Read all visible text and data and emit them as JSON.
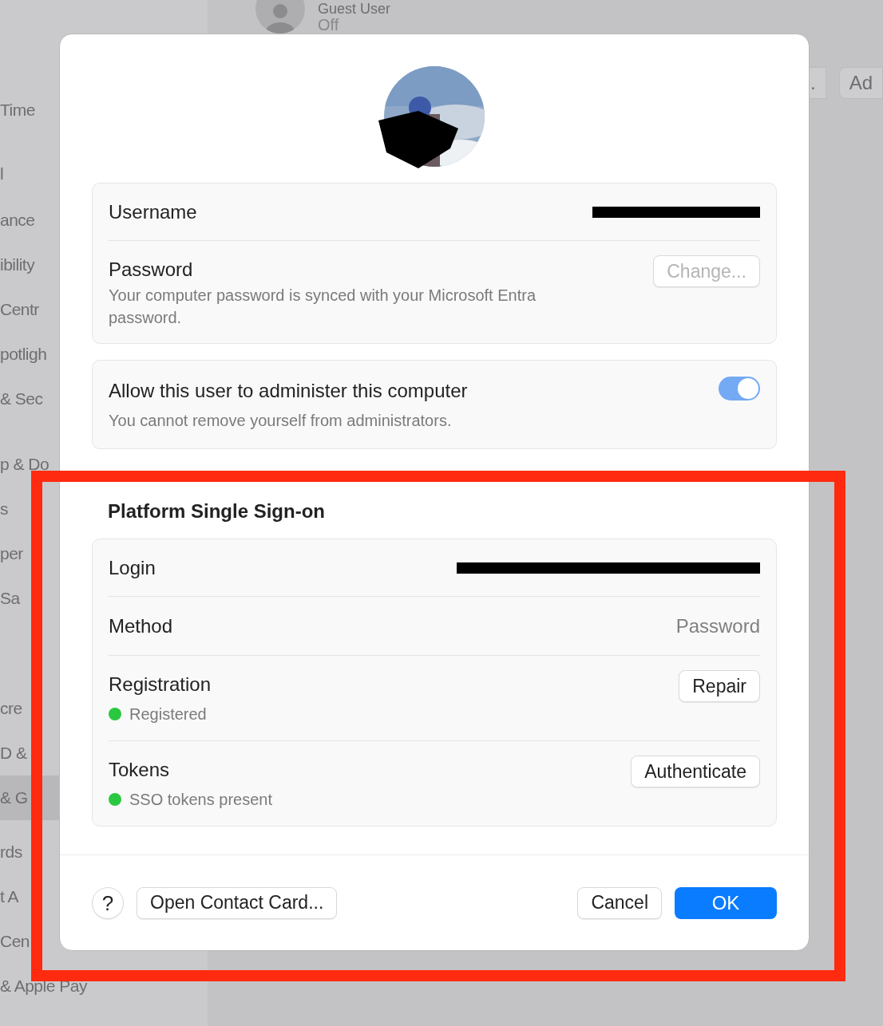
{
  "background": {
    "guest_user": {
      "name": "Guest User",
      "status": "Off"
    },
    "toolbar_buttons": [
      ".",
      "Ad"
    ],
    "sidebar": {
      "items": [
        {
          "label": "Time",
          "selected": false
        },
        {
          "label": "l",
          "selected": false
        },
        {
          "label": "ance",
          "selected": false
        },
        {
          "label": "ibility",
          "selected": false
        },
        {
          "label": "Centr",
          "selected": false
        },
        {
          "label": "potligh",
          "selected": false
        },
        {
          "label": "& Sec",
          "selected": false
        },
        {
          "label": "p & Do",
          "selected": false
        },
        {
          "label": "s",
          "selected": false
        },
        {
          "label": "per",
          "selected": false
        },
        {
          "label": "Sa",
          "selected": false
        },
        {
          "label": "cre",
          "selected": false
        },
        {
          "label": "D &",
          "selected": false
        },
        {
          "label": "& G",
          "selected": true
        },
        {
          "label": "rds",
          "selected": false
        },
        {
          "label": "t A",
          "selected": false
        },
        {
          "label": "Cen",
          "selected": false
        },
        {
          "label": "& Apple Pay",
          "selected": false
        }
      ]
    }
  },
  "dialog": {
    "account": {
      "username_label": "Username",
      "password_label": "Password",
      "password_note": "Your computer password is synced with your Microsoft Entra password.",
      "change_button": {
        "label": "Change...",
        "disabled": true
      }
    },
    "admin": {
      "label": "Allow this user to administer this computer",
      "note": "You cannot remove yourself from administrators.",
      "on": true
    },
    "sso": {
      "title": "Platform Single Sign-on",
      "rows": [
        {
          "kind": "redacted",
          "label": "Login"
        },
        {
          "kind": "value",
          "label": "Method",
          "value": "Password"
        },
        {
          "kind": "status",
          "label": "Registration",
          "status": "Registered",
          "color": "#2ac840",
          "button": "Repair"
        },
        {
          "kind": "status",
          "label": "Tokens",
          "status": "SSO tokens present",
          "color": "#2ac840",
          "button": "Authenticate"
        }
      ]
    },
    "footer": {
      "help": "?",
      "contact_button": "Open Contact Card...",
      "cancel": "Cancel",
      "ok": "OK"
    }
  }
}
